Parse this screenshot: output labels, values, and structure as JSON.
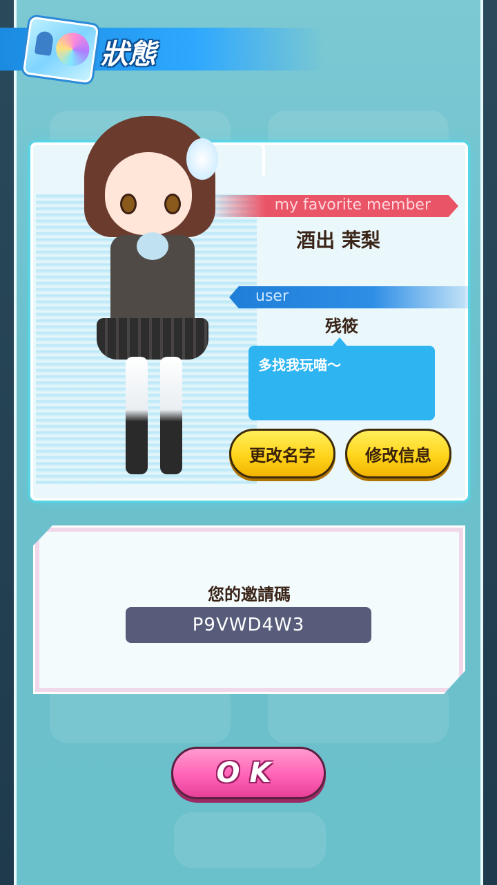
{
  "header": {
    "title": "狀態",
    "icon": "profile-card-icon"
  },
  "profile": {
    "favorite_label": "my favorite member",
    "favorite_name": "酒出 茉梨",
    "user_label": "user",
    "user_name": "残筱",
    "comment": "多找我玩喵～"
  },
  "buttons": {
    "rename": "更改名字",
    "edit_info": "修改信息",
    "ok": "OK"
  },
  "invite": {
    "title": "您的邀請碼",
    "code": "P9VWD4W3"
  },
  "colors": {
    "accent_blue": "#2fb4f2",
    "favorite_red": "#ea5467",
    "button_yellow": "#ffd51c",
    "ok_pink": "#ff63b6",
    "code_box": "#565c7a"
  }
}
